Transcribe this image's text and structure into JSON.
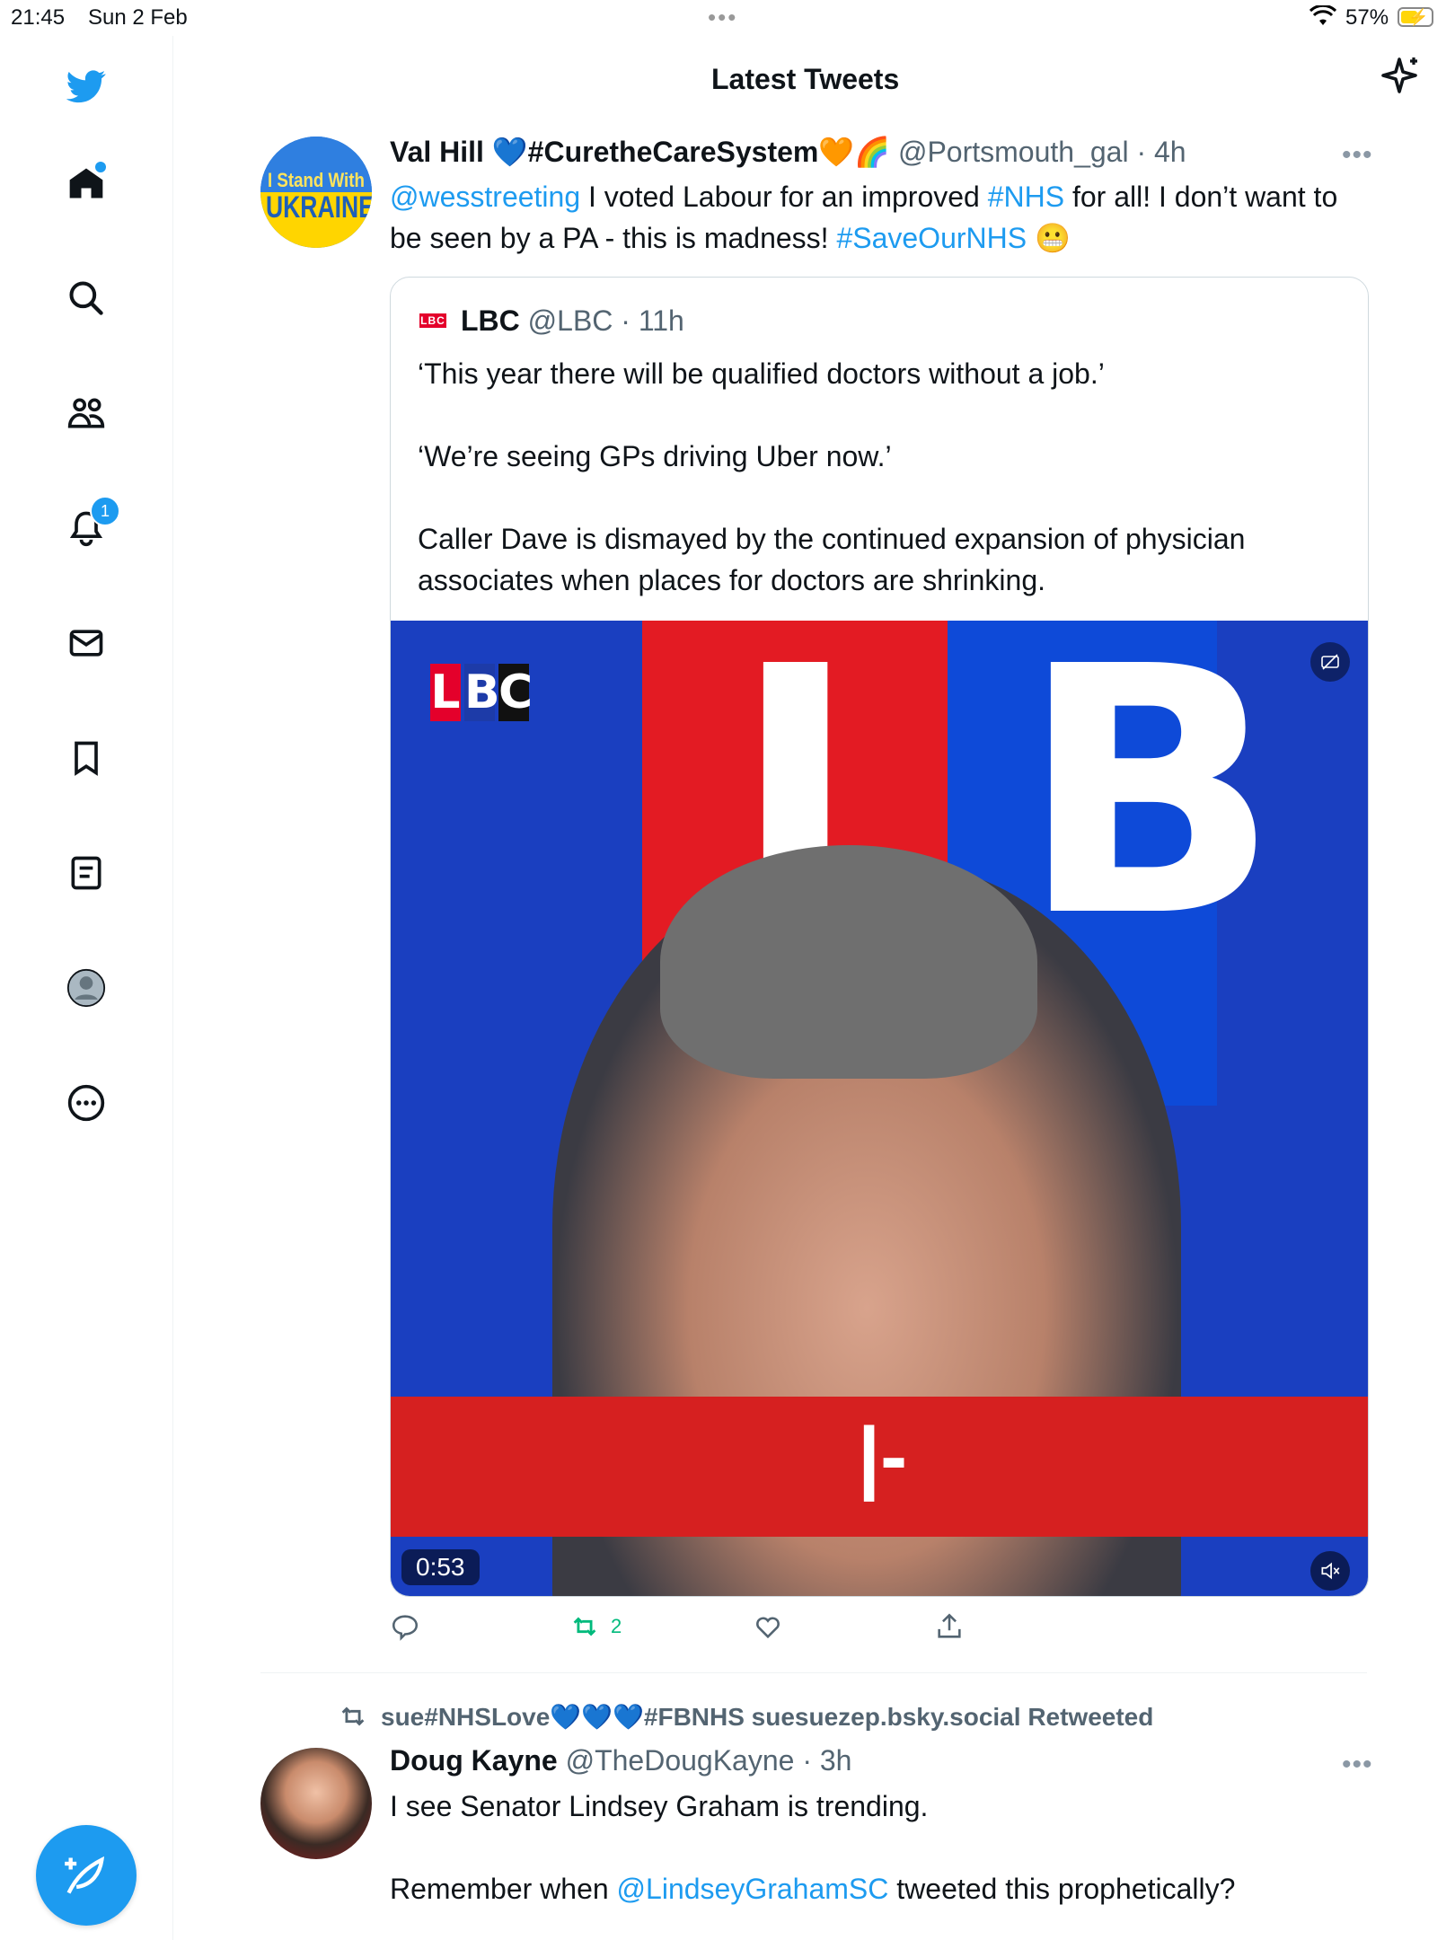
{
  "status_bar": {
    "time": "21:45",
    "date": "Sun 2 Feb",
    "dots": "•••",
    "battery_percent": "57%",
    "battery_level": 0.57
  },
  "sidebar": {
    "items": [
      {
        "name": "twitter-logo-icon"
      },
      {
        "name": "home-icon"
      },
      {
        "name": "search-icon"
      },
      {
        "name": "communities-icon"
      },
      {
        "name": "notifications-icon",
        "badge": "1"
      },
      {
        "name": "messages-icon"
      },
      {
        "name": "bookmarks-icon"
      },
      {
        "name": "lists-icon"
      },
      {
        "name": "profile-icon"
      },
      {
        "name": "more-icon"
      }
    ],
    "compose_label": "+"
  },
  "header": {
    "title": "Latest Tweets"
  },
  "tweet1": {
    "avatar_line1": "I Stand With",
    "avatar_line2": "UKRAINE",
    "display_name_part1": "Val Hill ",
    "heart1": "💙",
    "display_name_part2": "#CuretheCareSystem",
    "heart2": "🧡🌈",
    "handle": "@Portsmouth_gal",
    "time": "4h",
    "more": "•••",
    "mention": "@wesstreeting",
    "text_a": " I voted Labour for an improved ",
    "hashtag1": "#NHS",
    "text_b": " for all!  I don’t want to be seen by a PA - this is madness! ",
    "hashtag2": "#SaveOurNHS",
    "emoji": " 😬",
    "quote": {
      "logo_text": "LBC",
      "name": "LBC",
      "handle": "@LBC",
      "time": "11h",
      "para1": "‘This year there will be qualified doctors without a job.’",
      "para2": "‘We’re seeing GPs driving Uber now.’",
      "para3": "Caller Dave is dismayed by the continued expansion of physician associates when places for doctors are shrinking.",
      "video": {
        "logo_l": "L",
        "logo_b": "B",
        "logo_c": "C",
        "backdrop_i": "I",
        "backdrop_b": "B",
        "bar_text": "|-",
        "timer": "0:53"
      }
    },
    "actions": {
      "reply_count": "",
      "retweet_count": "2",
      "like_count": "",
      "share": ""
    }
  },
  "tweet2": {
    "retweeted_by_prefix": "sue#NHSLove",
    "retweeted_by_hearts": "💙💙💙",
    "retweeted_by_suffix": "#FBNHS suesuezep.bsky.social Retweeted",
    "display_name": "Doug Kayne",
    "handle": "@TheDougKayne",
    "time": "3h",
    "more": "•••",
    "line1": "I see Senator Lindsey Graham is trending.",
    "line2_prefix": "Remember when ",
    "line2_mention": "@LindseyGrahamSC",
    "line2_suffix": " tweeted this prophetically?"
  },
  "colors": {
    "accent": "#1d9bf0",
    "retweet_green": "#00ba7c",
    "secondary_text": "#536471"
  }
}
